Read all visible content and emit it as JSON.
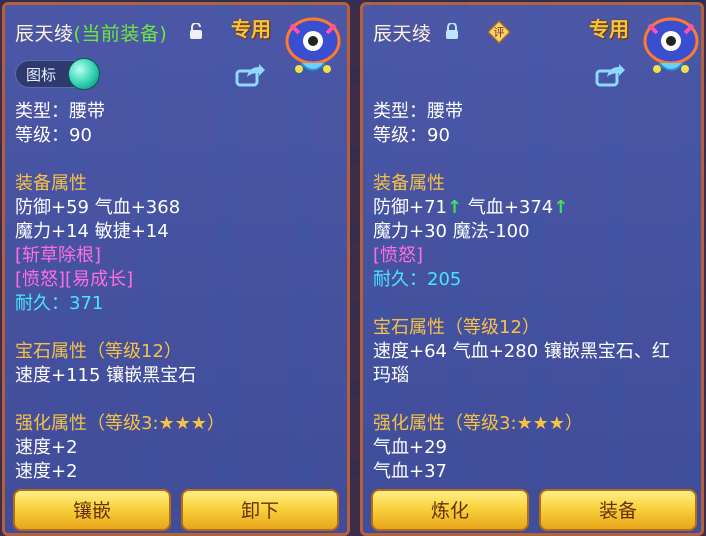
{
  "left": {
    "title_name": "辰天绫",
    "title_equipped": "(当前装备)",
    "exclusive": "专用",
    "icon_toggle_label": "图标",
    "lines": [
      {
        "text": "类型：腰带",
        "style": "normal"
      },
      {
        "text": "等级：90",
        "style": "normal"
      },
      {
        "text": "",
        "style": "gap"
      },
      {
        "text": "装备属性",
        "style": "sec"
      },
      {
        "text": "防御+59 气血+368",
        "style": "normal"
      },
      {
        "text": "魔力+14 敏捷+14",
        "style": "normal"
      },
      {
        "text": "[斩草除根]",
        "style": "special"
      },
      {
        "text": "[愤怒][易成长]",
        "style": "special"
      },
      {
        "text": "耐久：371",
        "style": "cyan"
      },
      {
        "text": "",
        "style": "gap"
      },
      {
        "text": "宝石属性（等级12）",
        "style": "sec"
      },
      {
        "text": "速度+115 镶嵌黑宝石",
        "style": "normal"
      },
      {
        "text": "",
        "style": "gap"
      },
      {
        "text": "强化属性（等级3:★★★）",
        "style": "sec"
      },
      {
        "text": "速度+2",
        "style": "normal"
      },
      {
        "text": "速度+2",
        "style": "normal"
      }
    ],
    "buttons": [
      "镶嵌",
      "卸下"
    ]
  },
  "right": {
    "title_name": "辰天绫",
    "badge": "评",
    "exclusive": "专用",
    "lines": [
      {
        "text": "类型：腰带",
        "style": "normal"
      },
      {
        "text": "等级：90",
        "style": "normal"
      },
      {
        "text": "",
        "style": "gap"
      },
      {
        "text": "装备属性",
        "style": "sec"
      },
      {
        "text": "防御+71↑ 气血+374↑",
        "style": "normal"
      },
      {
        "text": "魔力+30 魔法-100",
        "style": "normal"
      },
      {
        "text": "[愤怒]",
        "style": "special"
      },
      {
        "text": "耐久：205",
        "style": "cyan"
      },
      {
        "text": "",
        "style": "gap"
      },
      {
        "text": "宝石属性（等级12）",
        "style": "sec"
      },
      {
        "text": "速度+64 气血+280 镶嵌黑宝石、红",
        "style": "normal"
      },
      {
        "text": "玛瑙",
        "style": "normal"
      },
      {
        "text": "",
        "style": "gap"
      },
      {
        "text": "强化属性（等级3:★★★）",
        "style": "sec"
      },
      {
        "text": "气血+29",
        "style": "normal"
      },
      {
        "text": "气血+37",
        "style": "normal"
      }
    ],
    "buttons": [
      "炼化",
      "装备"
    ]
  },
  "colors": {
    "panel_border": "#b4603a",
    "section": "#f6c246",
    "special": "#ff6ee0",
    "durability": "#47e6ff",
    "title_equipped": "#6ee83a"
  }
}
